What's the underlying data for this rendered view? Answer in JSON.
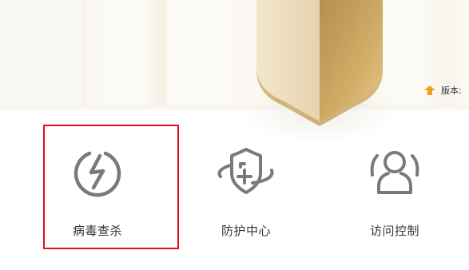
{
  "header": {
    "version_label": "版本:",
    "accent_color": "#f0a020"
  },
  "features": [
    {
      "label": "病毒查杀",
      "icon": "power-lightning-icon",
      "selected": true
    },
    {
      "label": "防护中心",
      "icon": "shield-plus-icon",
      "selected": false
    },
    {
      "label": "访问控制",
      "icon": "users-icon",
      "selected": false
    }
  ],
  "colors": {
    "icon": "#7a7a7a",
    "selection_border": "#e0101a",
    "shield_gold_light": "#ead9b4",
    "shield_gold_dark": "#c9a260"
  }
}
